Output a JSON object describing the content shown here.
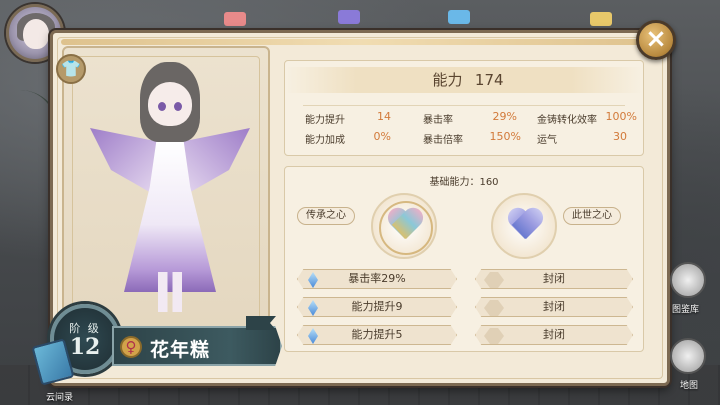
{
  "header": {
    "close_label": "×"
  },
  "character": {
    "level_label": "阶 级",
    "level": "12",
    "name": "花年糕",
    "gender_symbol": "♀"
  },
  "ability": {
    "title": "能力",
    "total": "174",
    "stats": [
      {
        "label": "能力提升",
        "value": "14"
      },
      {
        "label": "暴击率",
        "value": "29%"
      },
      {
        "label": "金铸转化效率",
        "value": "100%"
      },
      {
        "label": "能力加成",
        "value": "0%"
      },
      {
        "label": "暴击倍率",
        "value": "150%"
      },
      {
        "label": "运气",
        "value": "30"
      }
    ]
  },
  "base_ability": {
    "title": "基础能力：160",
    "left_heart_label": "传承之心",
    "right_heart_label": "此世之心",
    "left_slots": [
      "暴击率29%",
      "能力提升9",
      "能力提升5"
    ],
    "right_slots": [
      "封闭",
      "封闭",
      "封闭"
    ]
  },
  "sidebar": {
    "scroll_label": "云间录",
    "right_labels": [
      "图鉴库",
      "地图"
    ]
  },
  "colors": {
    "panel_bg": "#f3ead8",
    "accent_value": "#d27a3a",
    "badge_bg": "#2f4a52"
  }
}
